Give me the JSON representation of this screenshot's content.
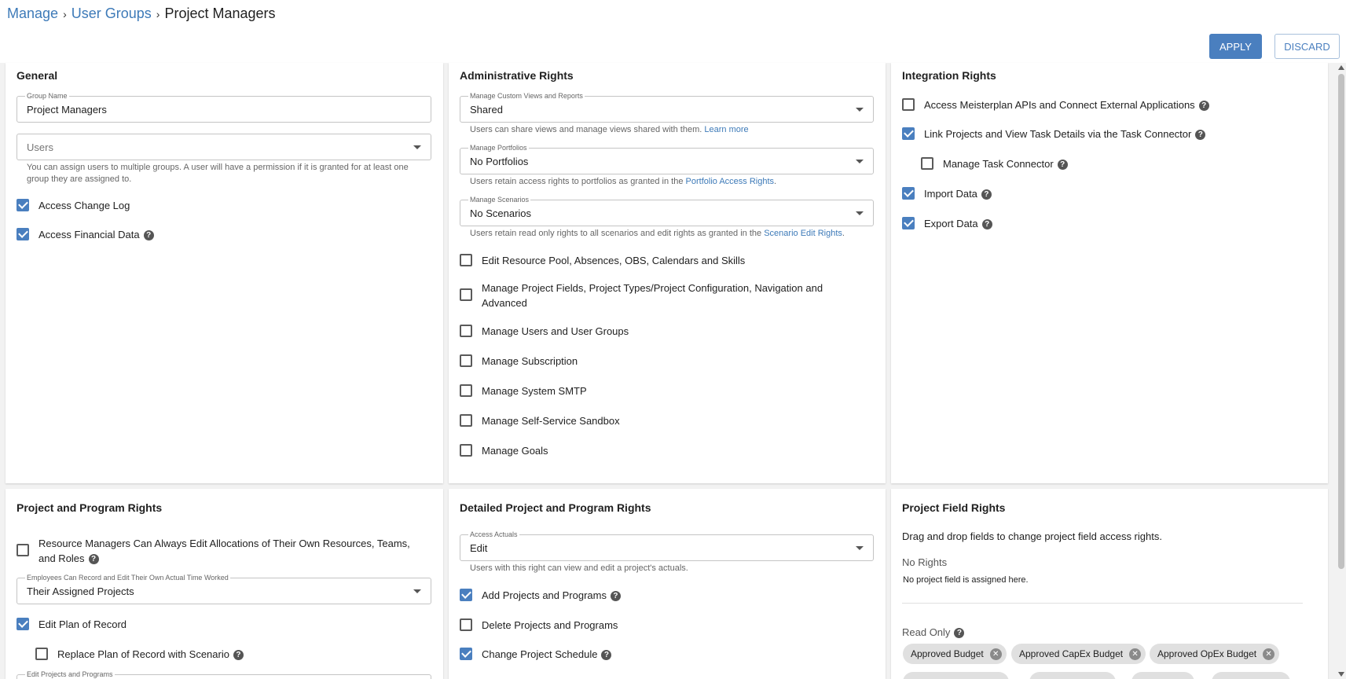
{
  "breadcrumb": {
    "manage": "Manage",
    "user_groups": "User Groups",
    "current": "Project Managers",
    "sep": "›"
  },
  "actions": {
    "apply": "APPLY",
    "discard": "DISCARD"
  },
  "general": {
    "title": "General",
    "group_name_label": "Group Name",
    "group_name_value": "Project Managers",
    "users_placeholder": "Users",
    "users_help": "You can assign users to multiple groups. A user will have a permission if it is granted for at least one group they are assigned to.",
    "access_change_log": {
      "label": "Access Change Log",
      "checked": true
    },
    "access_financial_data": {
      "label": "Access Financial Data",
      "checked": true
    }
  },
  "admin": {
    "title": "Administrative Rights",
    "custom_views": {
      "label": "Manage Custom Views and Reports",
      "value": "Shared",
      "help": "Users can share views and manage views shared with them.",
      "link": "Learn more"
    },
    "portfolios": {
      "label": "Manage Portfolios",
      "value": "No Portfolios",
      "help": "Users retain access rights to portfolios as granted in the",
      "link": "Portfolio Access Rights",
      "suffix": "."
    },
    "scenarios": {
      "label": "Manage Scenarios",
      "value": "No Scenarios",
      "help": "Users retain read only rights to all scenarios and edit rights as granted in the",
      "link": "Scenario Edit Rights",
      "suffix": "."
    },
    "items": [
      {
        "label": "Edit Resource Pool, Absences, OBS, Calendars and Skills",
        "checked": false
      },
      {
        "label": "Manage Project Fields, Project Types/Project Configuration, Navigation and",
        "label2": "Advanced",
        "checked": false
      },
      {
        "label": "Manage Users and User Groups",
        "checked": false
      },
      {
        "label": "Manage Subscription",
        "checked": false
      },
      {
        "label": "Manage System SMTP",
        "checked": false
      },
      {
        "label": "Manage Self-Service Sandbox",
        "checked": false
      },
      {
        "label": "Manage Goals",
        "checked": false
      }
    ]
  },
  "integration": {
    "title": "Integration Rights",
    "items": [
      {
        "label": "Access Meisterplan APIs and Connect External Applications",
        "checked": false
      },
      {
        "label": "Link Projects and View Task Details via the Task Connector",
        "checked": true
      },
      {
        "label": "Manage Task Connector",
        "checked": false
      },
      {
        "label": "Import Data",
        "checked": true
      },
      {
        "label": "Export Data",
        "checked": true
      }
    ]
  },
  "project_rights": {
    "title": "Project and Program Rights",
    "resource_managers": {
      "label": "Resource Managers Can Always Edit Allocations of Their Own Resources, Teams,",
      "label2": "and Roles",
      "checked": false
    },
    "employees_record": {
      "label": "Employees Can Record and Edit Their Own Actual Time Worked",
      "value": "Their Assigned Projects"
    },
    "edit_plan": {
      "label": "Edit Plan of Record",
      "checked": true
    },
    "replace_plan": {
      "label": "Replace Plan of Record with Scenario",
      "checked": false
    },
    "edit_projects_label": "Edit Projects and Programs"
  },
  "detailed_rights": {
    "title": "Detailed Project and Program Rights",
    "access_actuals": {
      "label": "Access Actuals",
      "value": "Edit",
      "help": "Users with this right can view and edit a project's actuals."
    },
    "add_projects": {
      "label": "Add Projects and Programs",
      "checked": true
    },
    "delete_projects": {
      "label": "Delete Projects and Programs",
      "checked": false
    },
    "change_schedule": {
      "label": "Change Project Schedule",
      "checked": true
    }
  },
  "field_rights": {
    "title": "Project Field Rights",
    "description": "Drag and drop fields to change project field access rights.",
    "no_rights_title": "No Rights",
    "no_rights_empty": "No project field is assigned here.",
    "read_only_title": "Read Only",
    "chips": [
      "Approved Budget",
      "Approved CapEx Budget",
      "Approved OpEx Budget"
    ]
  },
  "icons": {
    "help": "?",
    "remove": "✕"
  },
  "colors": {
    "accent": "#4a7fbf",
    "link": "#3d7ab8"
  }
}
